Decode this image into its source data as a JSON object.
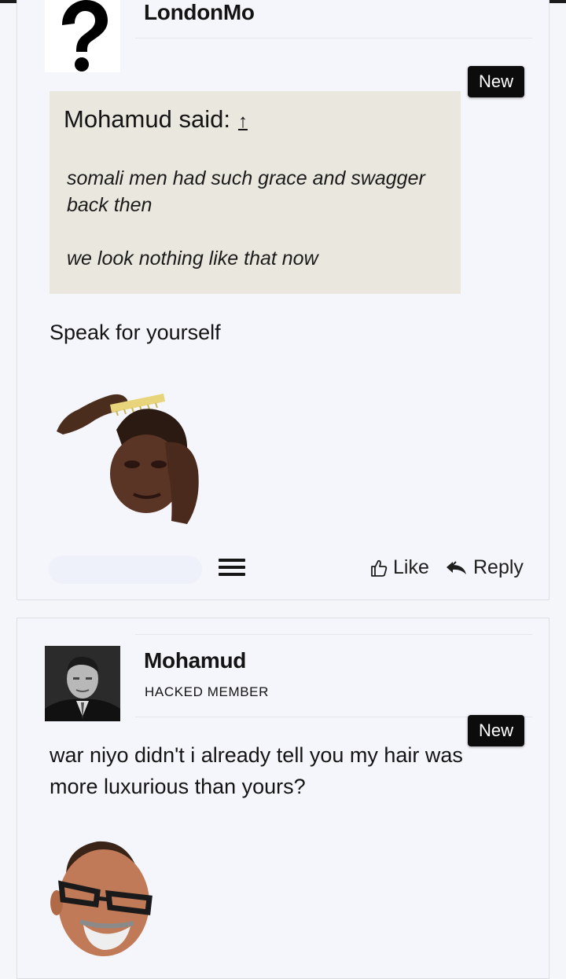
{
  "posts": [
    {
      "username": "LondonMo",
      "badge": "New",
      "quote": {
        "author_line": "Mohamud said:",
        "arrow": "↑",
        "lines": [
          "somali men had such grace and swagger back then",
          "we look nothing like that now"
        ]
      },
      "message": "Speak for yourself",
      "actions": {
        "like": "Like",
        "reply": "Reply"
      },
      "icons": {
        "avatar": "question-mark-avatar",
        "menu": "hamburger-menu-icon",
        "like": "thumbs-up-icon",
        "reply": "reply-icon"
      }
    },
    {
      "username": "Mohamud",
      "user_title": "HACKED MEMBER",
      "badge": "New",
      "message": "war niyo didn't i already tell you my hair was more luxurious than yours?",
      "icons": {
        "avatar": "portrait-avatar"
      }
    }
  ],
  "colors": {
    "badge_bg": "#0c0c0c",
    "quote_bg": "#eae8de",
    "page_bg": "#f5f6fa"
  }
}
